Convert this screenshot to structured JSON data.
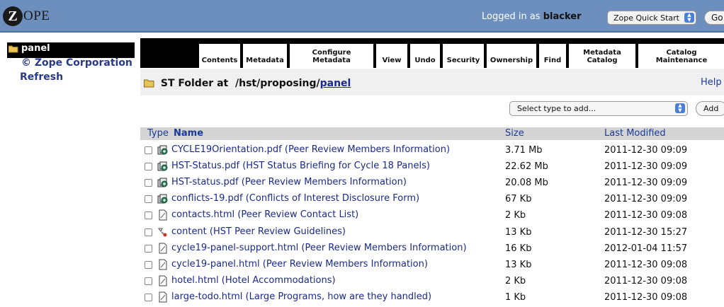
{
  "header": {
    "logo_letter": "Z",
    "logo_text": "OPE",
    "logged_in_prefix": "Logged in as",
    "username": "blacker",
    "quick_start": "Zope Quick Start",
    "go_label": "Go"
  },
  "sidebar": {
    "root_label": "panel",
    "copyright": "© Zope Corporation",
    "refresh": "Refresh"
  },
  "tabs": [
    {
      "label": "Contents"
    },
    {
      "label": "Metadata"
    },
    {
      "label": "Configure Metadata"
    },
    {
      "label": "View"
    },
    {
      "label": "Undo"
    },
    {
      "label": "Security"
    },
    {
      "label": "Ownership"
    },
    {
      "label": "Find"
    },
    {
      "label": "Metadata Catalog"
    },
    {
      "label": "Catalog Maintenance"
    }
  ],
  "main": {
    "folder_type": "ST Folder at",
    "path_prefix": "/hst/proposing/",
    "path_current": "panel",
    "help": "Help",
    "select_placeholder": "Select type to add...",
    "add_label": "Add"
  },
  "table": {
    "columns": {
      "type": "Type",
      "name": "Name",
      "size": "Size",
      "modified": "Last Modified"
    },
    "rows": [
      {
        "icon": "file-stack-icon",
        "name": "CYCLE19Orientation.pdf (Peer Review Members Information)",
        "size": "3.71 Mb",
        "modified": "2011-12-30 09:09"
      },
      {
        "icon": "file-stack-icon",
        "name": "HST-Status.pdf (HST Status Briefing for Cycle 18 Panels)",
        "size": "22.62 Mb",
        "modified": "2011-12-30 09:09"
      },
      {
        "icon": "file-stack-icon",
        "name": "HST-status.pdf (Peer Review Members Information)",
        "size": "20.08 Mb",
        "modified": "2011-12-30 09:09"
      },
      {
        "icon": "file-stack-icon",
        "name": "conflicts-19.pdf (Conflicts of Interest Disclosure Form)",
        "size": "67 Kb",
        "modified": "2011-12-30 09:09"
      },
      {
        "icon": "document-icon",
        "name": "contacts.html (Peer Review Contact List)",
        "size": "2 Kb",
        "modified": "2011-12-30 09:08"
      },
      {
        "icon": "script-icon",
        "name": "content (HST Peer Review Guidelines)",
        "size": "13 Kb",
        "modified": "2011-12-30 15:27"
      },
      {
        "icon": "document-icon",
        "name": "cycle19-panel-support.html (Peer Review Members Information)",
        "size": "16 Kb",
        "modified": "2012-01-04 11:57"
      },
      {
        "icon": "document-icon",
        "name": "cycle19-panel.html (Peer Review Members Information)",
        "size": "13 Kb",
        "modified": "2011-12-30 09:08"
      },
      {
        "icon": "document-icon",
        "name": "hotel.html (Hotel Accommodations)",
        "size": "2 Kb",
        "modified": "2011-12-30 09:08"
      },
      {
        "icon": "document-icon",
        "name": "large-todo.html (Large Programs, how are they handled)",
        "size": "1 Kb",
        "modified": "2011-12-30 09:08"
      }
    ]
  },
  "colors": {
    "topbar": "#6d8fbd",
    "link": "#1a2a8a",
    "table_header": "#d4d4d4"
  }
}
